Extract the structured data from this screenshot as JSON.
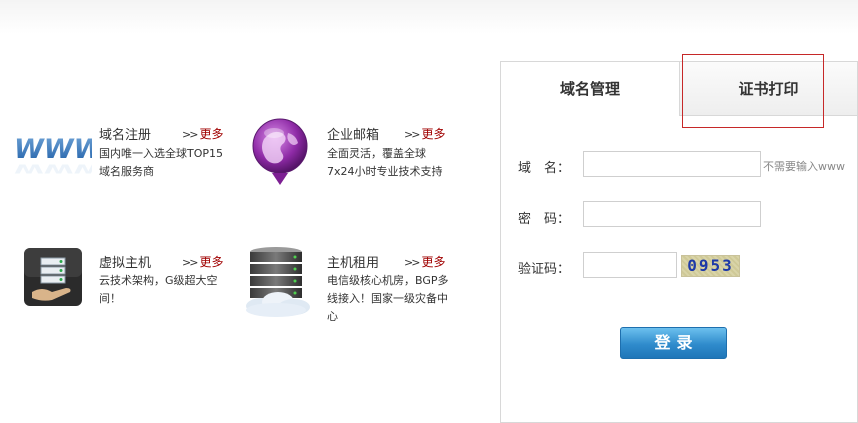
{
  "services": [
    {
      "icon": "www-icon",
      "title": "域名注册",
      "more": "更多",
      "desc": "国内唯一入选全球TOP15域名服务商"
    },
    {
      "icon": "mail-globe-icon",
      "title": "企业邮箱",
      "more": "更多",
      "desc": "全面灵活，覆盖全球7x24小时专业技术支持"
    },
    {
      "icon": "server-host-icon",
      "title": "虚拟主机",
      "more": "更多",
      "desc": "云技术架构，G级超大空间！"
    },
    {
      "icon": "server-rack-icon",
      "title": "主机租用",
      "more": "更多",
      "desc": "电信级核心机房，BGP多线接入！国家一级灾备中心"
    }
  ],
  "login": {
    "tabs": [
      "域名管理",
      "证书打印"
    ],
    "domain_label": "域　名：",
    "domain_value": "",
    "domain_hint": "不需要输入www",
    "password_label": "密　码：",
    "password_value": "",
    "captcha_label": "验证码：",
    "captcha_value": "",
    "captcha_code": "0953",
    "submit_label": "登录"
  },
  "colors": {
    "more_link": "#a00000",
    "button_blue": "#2f8bcc",
    "highlight_box": "#c62828",
    "captcha_text": "#1e3aa8"
  }
}
